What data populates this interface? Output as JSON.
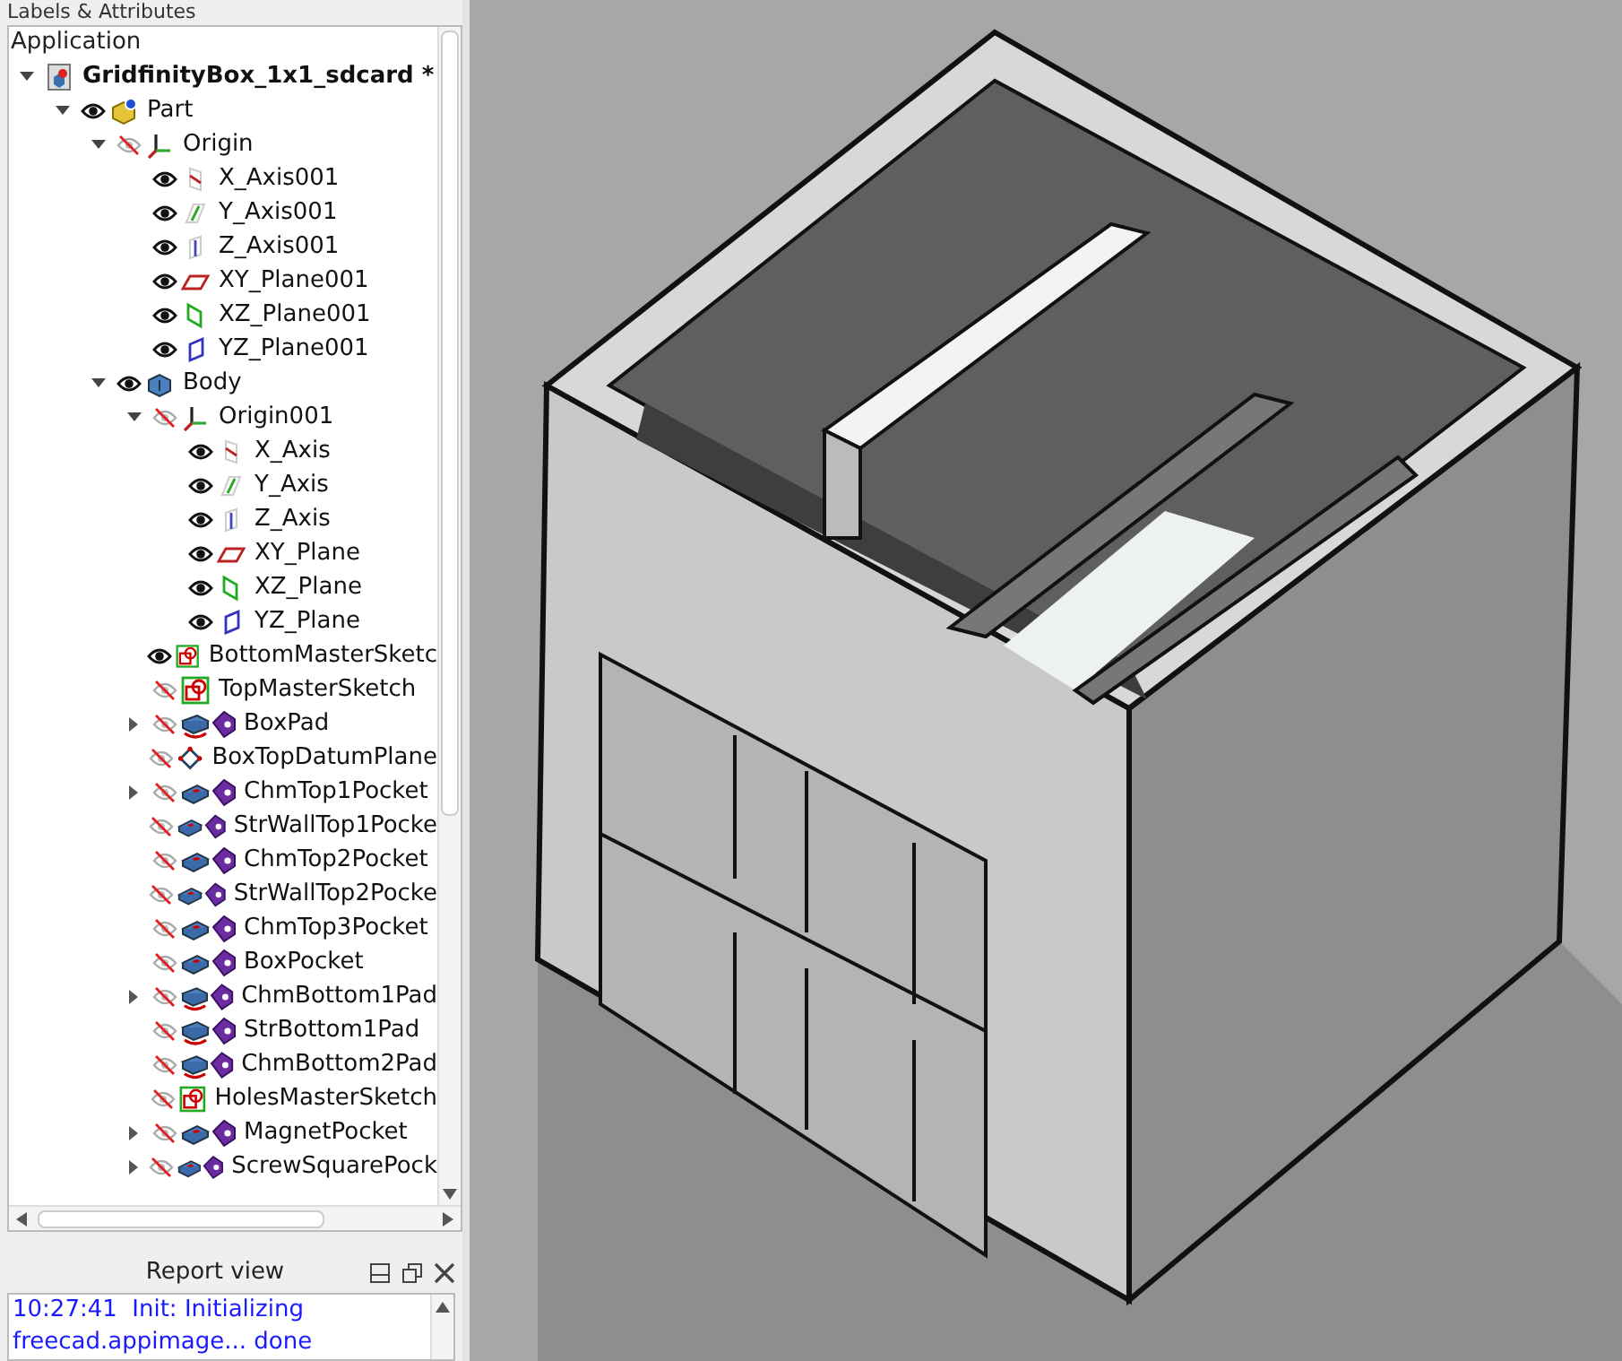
{
  "tree_panel": {
    "title": "Labels & Attributes",
    "header": "Application",
    "tree": [
      {
        "label": "GridfinityBox_1x1_sdcard *",
        "kind": "document",
        "expanded": true,
        "children": [
          {
            "label": "Part",
            "kind": "part",
            "visible": true,
            "expanded": true,
            "children": [
              {
                "label": "Origin",
                "kind": "origin",
                "visible": false,
                "expanded": true,
                "children": [
                  {
                    "label": "X_Axis001",
                    "kind": "axis-x",
                    "visible": true
                  },
                  {
                    "label": "Y_Axis001",
                    "kind": "axis-y",
                    "visible": true
                  },
                  {
                    "label": "Z_Axis001",
                    "kind": "axis-z",
                    "visible": true
                  },
                  {
                    "label": "XY_Plane001",
                    "kind": "plane-xy",
                    "visible": true
                  },
                  {
                    "label": "XZ_Plane001",
                    "kind": "plane-xz",
                    "visible": true
                  },
                  {
                    "label": "YZ_Plane001",
                    "kind": "plane-yz",
                    "visible": true
                  }
                ]
              },
              {
                "label": "Body",
                "kind": "body",
                "visible": true,
                "expanded": true,
                "children": [
                  {
                    "label": "Origin001",
                    "kind": "origin",
                    "visible": false,
                    "expanded": true,
                    "children": [
                      {
                        "label": "X_Axis",
                        "kind": "axis-x",
                        "visible": true
                      },
                      {
                        "label": "Y_Axis",
                        "kind": "axis-y",
                        "visible": true
                      },
                      {
                        "label": "Z_Axis",
                        "kind": "axis-z",
                        "visible": true
                      },
                      {
                        "label": "XY_Plane",
                        "kind": "plane-xy",
                        "visible": true
                      },
                      {
                        "label": "XZ_Plane",
                        "kind": "plane-xz",
                        "visible": true
                      },
                      {
                        "label": "YZ_Plane",
                        "kind": "plane-yz",
                        "visible": true
                      }
                    ]
                  },
                  {
                    "label": "BottomMasterSketc",
                    "kind": "sketch",
                    "visible": true
                  },
                  {
                    "label": "TopMasterSketch",
                    "kind": "sketch",
                    "visible": false
                  },
                  {
                    "label": "BoxPad",
                    "kind": "pad",
                    "visible": false,
                    "expanded": false
                  },
                  {
                    "label": "BoxTopDatumPlane",
                    "kind": "datum-plane",
                    "visible": false
                  },
                  {
                    "label": "ChmTop1Pocket",
                    "kind": "pocket",
                    "visible": false,
                    "expanded": false
                  },
                  {
                    "label": "StrWallTop1Pocke",
                    "kind": "pocket",
                    "visible": false
                  },
                  {
                    "label": "ChmTop2Pocket",
                    "kind": "pocket",
                    "visible": false
                  },
                  {
                    "label": "StrWallTop2Pocke",
                    "kind": "pocket",
                    "visible": false
                  },
                  {
                    "label": "ChmTop3Pocket",
                    "kind": "pocket",
                    "visible": false
                  },
                  {
                    "label": "BoxPocket",
                    "kind": "pocket",
                    "visible": false
                  },
                  {
                    "label": "ChmBottom1Pad",
                    "kind": "pad",
                    "visible": false,
                    "expanded": false
                  },
                  {
                    "label": "StrBottom1Pad",
                    "kind": "pad",
                    "visible": false
                  },
                  {
                    "label": "ChmBottom2Pad",
                    "kind": "pad",
                    "visible": false
                  },
                  {
                    "label": "HolesMasterSketch",
                    "kind": "sketch",
                    "visible": false
                  },
                  {
                    "label": "MagnetPocket",
                    "kind": "pocket",
                    "visible": false,
                    "expanded": false
                  },
                  {
                    "label": "ScrewSquarePock",
                    "kind": "pocket",
                    "visible": false,
                    "expanded": false
                  }
                ]
              }
            ]
          }
        ]
      }
    ]
  },
  "report_view": {
    "title": "Report view",
    "lines": [
      "10:27:41  Init: Initializing",
      "freecad.appimage... done"
    ]
  }
}
